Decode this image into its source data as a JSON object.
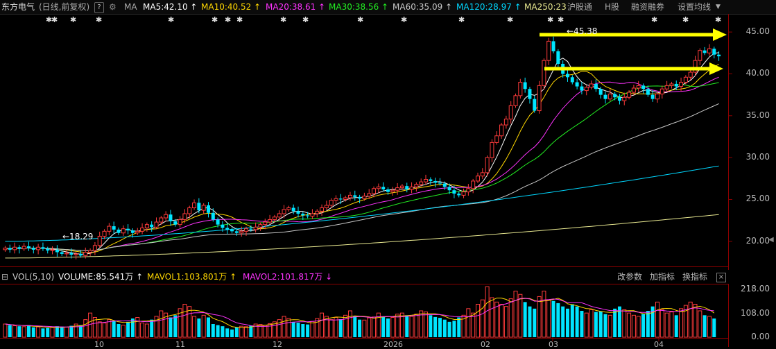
{
  "header": {
    "stock_name": "东方电气",
    "period": "(日线,前复权)",
    "help": "?",
    "ma_label": "MA",
    "ma_values": [
      {
        "text": "MA5:42.10",
        "arrow": "↑",
        "color": "#ffffff"
      },
      {
        "text": "MA10:40.52",
        "arrow": "↑",
        "color": "#ffd700"
      },
      {
        "text": "MA20:38.61",
        "arrow": "↑",
        "color": "#ff33ff"
      },
      {
        "text": "MA30:38.56",
        "arrow": "↑",
        "color": "#22ee22"
      },
      {
        "text": "MA60:35.09",
        "arrow": "↑",
        "color": "#c8c8c8"
      },
      {
        "text": "MA120:28.97",
        "arrow": "↑",
        "color": "#00d7ff"
      },
      {
        "text": "MA250:23",
        "arrow": "",
        "color": "#e8e890"
      }
    ],
    "menu": [
      "沪股通",
      "H股",
      "融资融券",
      "设置均线"
    ]
  },
  "volume_header": {
    "label": "VOL(5,10)",
    "volume": "VOLUME:85.541万",
    "volume_arrow": "↑",
    "mavol1": "MAVOL1:103.801万",
    "mavol1_arrow": "↑",
    "mavol2": "MAVOL2:101.817万",
    "mavol2_arrow": "↓",
    "buttons": [
      "改参数",
      "加指标",
      "换指标"
    ],
    "close": "×"
  },
  "price_axis": [
    "45.00",
    "40.00",
    "35.00",
    "30.00",
    "25.00",
    "20.00"
  ],
  "volume_axis": [
    "218.00",
    "108.00",
    "0.00"
  ],
  "date_labels": [
    "10",
    "11",
    "12",
    "2026",
    "02",
    "03",
    "04"
  ],
  "annotations": {
    "high": "←45.38",
    "low": "←18.29"
  },
  "markers": [
    "✱",
    "✱",
    "✱",
    "✱",
    "✱",
    "✱",
    "✱",
    "✱",
    "✱",
    "✱",
    "✱",
    "✱",
    "✱",
    "✱",
    "✱",
    "✱",
    "✱",
    "✱",
    "✱",
    "✱",
    "✱"
  ],
  "chart_data": {
    "type": "candlestick",
    "ylim": [
      17,
      47
    ],
    "volume_ylim": [
      0,
      240
    ],
    "closes": [
      19.2,
      19.0,
      19.3,
      19.1,
      19.4,
      19.2,
      19.0,
      19.3,
      19.1,
      18.9,
      19.0,
      18.7,
      18.5,
      18.6,
      18.4,
      18.5,
      18.3,
      18.7,
      18.9,
      19.5,
      20.6,
      21.2,
      21.8,
      21.4,
      21.0,
      21.5,
      21.3,
      21.0,
      21.2,
      21.6,
      22.0,
      21.7,
      22.3,
      22.8,
      23.2,
      22.4,
      22.0,
      22.6,
      23.3,
      24.0,
      24.6,
      23.7,
      24.3,
      23.4,
      22.6,
      22.0,
      21.6,
      21.4,
      21.2,
      21.0,
      21.2,
      21.5,
      21.4,
      21.7,
      22.0,
      22.3,
      22.6,
      22.9,
      23.3,
      23.8,
      24.0,
      23.6,
      23.3,
      23.1,
      23.0,
      23.3,
      23.6,
      24.0,
      24.3,
      24.9,
      25.1,
      25.0,
      25.2,
      25.5,
      25.3,
      25.1,
      25.4,
      25.7,
      26.3,
      26.5,
      26.2,
      25.9,
      26.1,
      26.4,
      26.6,
      26.2,
      26.5,
      26.8,
      27.1,
      27.4,
      27.2,
      27.0,
      26.9,
      26.5,
      26.1,
      25.7,
      25.5,
      25.9,
      26.3,
      27.2,
      27.8,
      28.2,
      30.0,
      31.8,
      32.6,
      33.9,
      34.6,
      36.2,
      37.4,
      39.0,
      38.2,
      37.0,
      35.6,
      38.6,
      41.6,
      43.9,
      42.7,
      41.2,
      40.0,
      39.6,
      39.0,
      38.5,
      38.0,
      38.4,
      38.8,
      38.2,
      37.5,
      37.0,
      37.6,
      37.2,
      36.8,
      37.2,
      37.8,
      38.3,
      38.6,
      38.2,
      37.5,
      37.0,
      37.6,
      38.2,
      38.6,
      38.8,
      38.5,
      39.0,
      39.6,
      40.2,
      41.6,
      42.8,
      42.5,
      43.0,
      42.3,
      42.1
    ],
    "volumes": [
      60,
      55,
      52,
      50,
      48,
      55,
      45,
      47,
      40,
      42,
      45,
      50,
      48,
      46,
      52,
      60,
      55,
      80,
      110,
      90,
      70,
      65,
      80,
      75,
      60,
      55,
      70,
      85,
      90,
      65,
      60,
      80,
      95,
      120,
      110,
      90,
      100,
      130,
      150,
      140,
      95,
      85,
      100,
      90,
      60,
      55,
      50,
      40,
      35,
      45,
      50,
      48,
      52,
      60,
      58,
      55,
      62,
      70,
      80,
      95,
      85,
      70,
      66,
      60,
      58,
      72,
      85,
      110,
      95,
      80,
      90,
      82,
      100,
      120,
      95,
      80,
      78,
      88,
      92,
      110,
      95,
      85,
      90,
      105,
      110,
      100,
      95,
      105,
      120,
      115,
      100,
      92,
      88,
      80,
      70,
      75,
      90,
      100,
      130,
      110,
      150,
      170,
      230,
      180,
      160,
      150,
      140,
      175,
      210,
      195,
      160,
      140,
      130,
      185,
      210,
      170,
      165,
      155,
      140,
      130,
      150,
      140,
      120,
      110,
      125,
      115,
      118,
      105,
      100,
      130,
      140,
      125,
      110,
      100,
      95,
      105,
      120,
      140,
      160,
      125,
      110,
      115,
      100,
      130,
      145,
      160,
      150,
      120,
      100,
      95,
      85
    ],
    "moving_averages": {
      "ma120": [
        [
          0,
          20.0
        ],
        [
          150,
          29.0
        ]
      ],
      "ma250": [
        [
          0,
          18.0
        ],
        [
          150,
          23.2
        ]
      ]
    },
    "high_label_value": 45.38,
    "low_label_value": 18.29
  }
}
